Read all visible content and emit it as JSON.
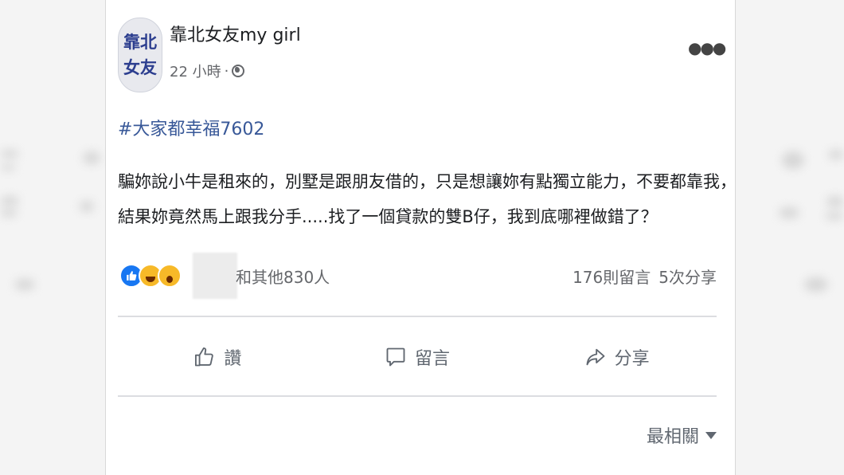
{
  "post": {
    "page_name": "靠北女友my girl",
    "avatar_text": [
      "靠北",
      "女友"
    ],
    "time": "22 小時",
    "time_sep": "·",
    "hashtag": "#大家都幸福7602",
    "body_lines": [
      "騙妳說小牛是租來的，別墅是跟朋友借的，只是想讓妳有點獨立能力，不要都靠我，",
      "結果妳竟然馬上跟我分手.....找了一個貸款的雙B仔，我到底哪裡做錯了？"
    ],
    "reactions": {
      "types": [
        "like",
        "haha",
        "wow"
      ],
      "others_text": "和其他830人",
      "comments": "176則留言",
      "shares": "5次分享"
    },
    "actions": {
      "like": "讚",
      "comment": "留言",
      "share": "分享"
    },
    "sort_label": "最相關"
  },
  "icons": {
    "more": "more-horizontal-icon",
    "privacy": "globe-icon",
    "like": "thumbs-up-icon",
    "comment": "comment-bubble-icon",
    "share": "share-arrow-icon",
    "sort": "caret-down-icon"
  },
  "colors": {
    "hashtag": "#385898",
    "like_reaction": "#1877f2",
    "emoji_reaction": "#f7b928"
  }
}
